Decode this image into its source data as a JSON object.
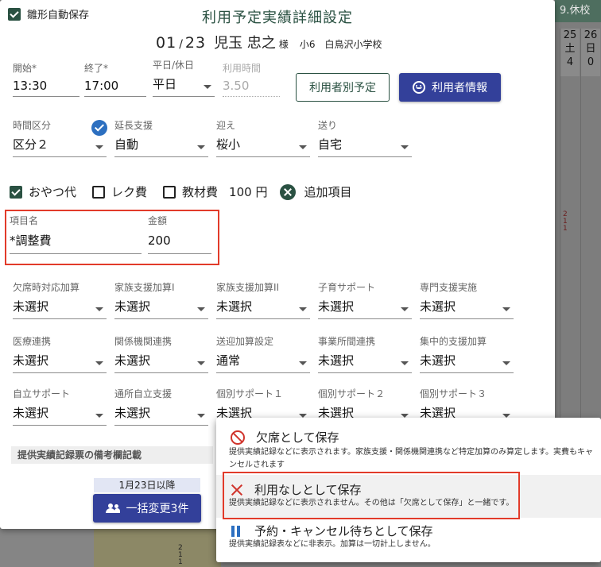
{
  "background": {
    "top_label": "9.休校",
    "columns": [
      {
        "day": "25",
        "weekday": "土",
        "count": "4"
      },
      {
        "day": "26",
        "weekday": "日",
        "count": "0"
      }
    ],
    "marks": [
      "2",
      "1",
      "1"
    ]
  },
  "dialog": {
    "autosave_label": "雛形自動保存",
    "title": "利用予定実績詳細設定",
    "user": {
      "month": "01",
      "slash": "/",
      "day": "23",
      "name": "児玉 忠之",
      "honorific": "様",
      "grade": "小6",
      "school": "白鳥沢小学校"
    },
    "time": {
      "start_label": "開始*",
      "start_value": "13:30",
      "end_label": "終了*",
      "end_value": "17:00",
      "daytype_label": "平日/休日",
      "daytype_value": "平日",
      "usage_label": "利用時間",
      "usage_value": "3.50"
    },
    "buttons": {
      "per_user_plan": "利用者別予定",
      "user_info": "利用者情報"
    },
    "row2": {
      "division_label": "時間区分",
      "division_value": "区分２",
      "extension_label": "延長支援",
      "extension_value": "自動",
      "pickup_label": "迎え",
      "pickup_value": "桜小",
      "dropoff_label": "送り",
      "dropoff_value": "自宅"
    },
    "extras": {
      "snack_label": "おやつ代",
      "rec_label": "レク費",
      "material_label": "教材費",
      "total": "100 円",
      "add_item_label": "追加項目"
    },
    "custom_item": {
      "name_label": "項目名",
      "name_value": "*調整費",
      "amount_label": "金額",
      "amount_value": "200"
    },
    "addons": [
      {
        "label": "欠席時対応加算",
        "value": "未選択"
      },
      {
        "label": "家族支援加算I",
        "value": "未選択"
      },
      {
        "label": "家族支援加算II",
        "value": "未選択"
      },
      {
        "label": "子育サポート",
        "value": "未選択"
      },
      {
        "label": "専門支援実施",
        "value": "未選択"
      },
      {
        "label": "医療連携",
        "value": "未選択"
      },
      {
        "label": "関係機関連携",
        "value": "未選択"
      },
      {
        "label": "送迎加算設定",
        "value": "通常"
      },
      {
        "label": "事業所間連携",
        "value": "未選択"
      },
      {
        "label": "集中的支援加算",
        "value": "未選択"
      },
      {
        "label": "自立サポート",
        "value": "未選択"
      },
      {
        "label": "通所自立支援",
        "value": "未選択"
      },
      {
        "label": "個別サポート１",
        "value": "未選択"
      },
      {
        "label": "個別サポート２",
        "value": "未選択"
      },
      {
        "label": "個別サポート３",
        "value": "未選択"
      }
    ],
    "remarks_label": "提供実績記録票の備考欄記載",
    "bulk": {
      "since_label": "1月23日以降",
      "button_label": "一括変更3件"
    }
  },
  "save_menu": {
    "absent": {
      "title": "欠席として保存",
      "desc": "提供実績記録などに表示されます。家族支援・関係機関連携など特定加算のみ算定します。実費もキャンセルされます"
    },
    "no_use": {
      "title": "利用なしとして保存",
      "desc": "提供実績記録などに表示されません。その他は「欠席として保存」と一緒です。"
    },
    "waitlist": {
      "title": "予約・キャンセル待ちとして保存",
      "desc": "提供実績記録表などに非表示。加算は一切計上しません。"
    }
  },
  "colors": {
    "primary_green": "#2a5142",
    "primary_indigo": "#33409a",
    "highlight_red": "#e23b2a",
    "check_blue": "#2c6fc0"
  }
}
